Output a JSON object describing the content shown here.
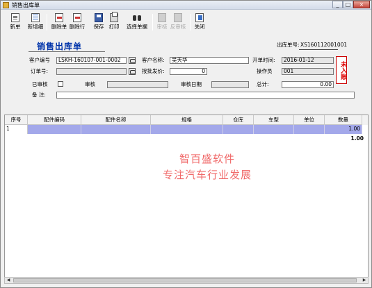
{
  "window": {
    "title": "销售出库单",
    "min": "_",
    "max": "□",
    "close": "×"
  },
  "toolbar": {
    "new": "新单",
    "add_detail": "新增细",
    "delete_doc": "删除单",
    "delete_row": "删除行",
    "save": "保存",
    "print": "打印",
    "select_doc": "选择单据",
    "audit": "审核",
    "unaudit": "反审核",
    "close": "关闭"
  },
  "form": {
    "title": "销售出库单",
    "doc_no_label": "出库单号:",
    "doc_no": "XS160112001001",
    "customer_code_label": "客户编号",
    "customer_code": "LSKH-160107-001-0002",
    "customer_name_label": "客户名称:",
    "customer_name": "吴天华",
    "open_time_label": "开单时间:",
    "open_time": "2016-01-12",
    "order_no_label": "订单号:",
    "order_no": "",
    "wholesale_label": "按批发价:",
    "wholesale_value": "0",
    "operator_label": "操作员",
    "operator": "001",
    "audited_label": "已审核",
    "auditor_label": "审核",
    "auditor": "",
    "audit_date_label": "审核日期",
    "audit_date": "",
    "total_label": "总计:",
    "total": "0.00",
    "remark_label": "备  注:",
    "remark": "",
    "stamp": "未入账"
  },
  "grid": {
    "columns": [
      "序号",
      "配件编码",
      "配件名称",
      "规格",
      "仓库",
      "车型",
      "单位",
      "数量"
    ],
    "rows": [
      {
        "index": "1",
        "code": "",
        "name": "",
        "spec": "",
        "warehouse": "",
        "model": "",
        "unit": "",
        "qty": "1.00"
      }
    ],
    "total_qty": "1.00"
  },
  "watermark": {
    "line1": "智百盛软件",
    "line2": "专注汽车行业发展"
  },
  "scrollbar": {
    "left_arrow": "◀",
    "right_arrow": "▶"
  },
  "colors": {
    "selected_row": "#a3a8ea",
    "title_blue": "#0033aa",
    "watermark": "#f06a6a",
    "stamp_red": "#dd0000"
  }
}
